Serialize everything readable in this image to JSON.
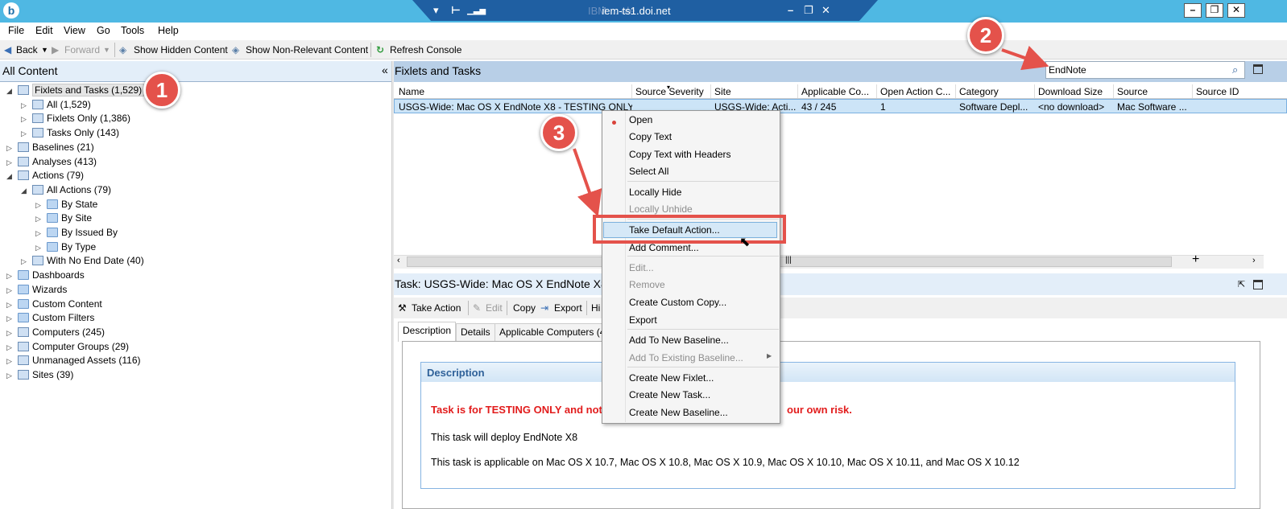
{
  "window": {
    "rdp_host": "iem-ts1.doi.net",
    "rdp_ghost_title": "IBM ... ole"
  },
  "menu": [
    "File",
    "Edit",
    "View",
    "Go",
    "Tools",
    "Help"
  ],
  "toolbar": {
    "back": "Back",
    "forward": "Forward",
    "show_hidden": "Show Hidden Content",
    "show_nonrelevant": "Show Non-Relevant Content",
    "refresh": "Refresh Console"
  },
  "left_pane": {
    "title": "All Content",
    "tree": [
      {
        "label": "Fixlets and Tasks (1,529)",
        "level": 0,
        "expanded": true,
        "selected": true
      },
      {
        "label": "All (1,529)",
        "level": 1
      },
      {
        "label": "Fixlets Only (1,386)",
        "level": 1
      },
      {
        "label": "Tasks Only (143)",
        "level": 1
      },
      {
        "label": "Baselines (21)",
        "level": 0
      },
      {
        "label": "Analyses (413)",
        "level": 0
      },
      {
        "label": "Actions (79)",
        "level": 0,
        "expanded": true
      },
      {
        "label": "All Actions (79)",
        "level": 1,
        "expanded": true
      },
      {
        "label": "By State",
        "level": 2
      },
      {
        "label": "By Site",
        "level": 2
      },
      {
        "label": "By Issued By",
        "level": 2
      },
      {
        "label": "By Type",
        "level": 2
      },
      {
        "label": "With No End Date (40)",
        "level": 1
      },
      {
        "label": "Dashboards",
        "level": 0
      },
      {
        "label": "Wizards",
        "level": 0
      },
      {
        "label": "Custom Content",
        "level": 0
      },
      {
        "label": "Custom Filters",
        "level": 0
      },
      {
        "label": "Computers (245)",
        "level": 0
      },
      {
        "label": "Computer Groups (29)",
        "level": 0
      },
      {
        "label": "Unmanaged Assets (116)",
        "level": 0
      },
      {
        "label": "Sites (39)",
        "level": 0
      }
    ]
  },
  "fixlets_pane": {
    "title": "Fixlets and Tasks",
    "search_value": "EndNote",
    "columns": [
      "Name",
      "Source Severity",
      "Site",
      "Applicable Co...",
      "Open Action C...",
      "Category",
      "Download Size",
      "Source",
      "Source ID"
    ],
    "row": [
      "USGS-Wide: Mac OS X EndNote X8 - TESTING ONLY",
      "",
      "USGS-Wide: Acti...",
      "43 / 245",
      "1",
      "Software Depl...",
      "<no download>",
      "Mac Software ...",
      ""
    ]
  },
  "task_pane": {
    "title": "Task: USGS-Wide: Mac OS X EndNote X8",
    "toolbar": {
      "take_action": "Take Action",
      "edit": "Edit",
      "copy": "Copy",
      "export": "Export",
      "hide": "Hi"
    },
    "tabs": [
      "Description",
      "Details",
      "Applicable Computers (4"
    ],
    "desc_title": "Description",
    "warning_left": "Task is for TESTING ONLY and not",
    "warning_right": "our own risk.",
    "deploy_text": "This task will deploy EndNote X8",
    "applicable_text": "This task is applicable on Mac OS X 10.7, Mac OS X 10.8, Mac OS X 10.9, Mac OS X 10.10, Mac OS X 10.11, and Mac OS X 10.12"
  },
  "context_menu": {
    "items": [
      {
        "label": "Open",
        "enabled": true
      },
      {
        "label": "Copy Text",
        "enabled": true
      },
      {
        "label": "Copy Text with Headers",
        "enabled": true
      },
      {
        "label": "Select All",
        "enabled": true
      },
      {
        "label": "Locally Hide",
        "enabled": true
      },
      {
        "label": "Locally Unhide",
        "enabled": false
      },
      {
        "label": "Take Default Action...",
        "enabled": true,
        "highlighted": true
      },
      {
        "label": "Add Comment...",
        "enabled": true
      },
      {
        "label": "Edit...",
        "enabled": false
      },
      {
        "label": "Remove",
        "enabled": false
      },
      {
        "label": "Create Custom Copy...",
        "enabled": true
      },
      {
        "label": "Export",
        "enabled": true
      },
      {
        "label": "Add To New Baseline...",
        "enabled": true
      },
      {
        "label": "Add To Existing Baseline...",
        "enabled": false
      },
      {
        "label": "Create New Fixlet...",
        "enabled": true
      },
      {
        "label": "Create New Task...",
        "enabled": true
      },
      {
        "label": "Create New Baseline...",
        "enabled": true
      }
    ]
  },
  "annotations": [
    "1",
    "2",
    "3"
  ],
  "colors": {
    "accent_red": "#e4524b",
    "warning_red": "#e21c1c",
    "title_blue": "#4fb8e3"
  }
}
